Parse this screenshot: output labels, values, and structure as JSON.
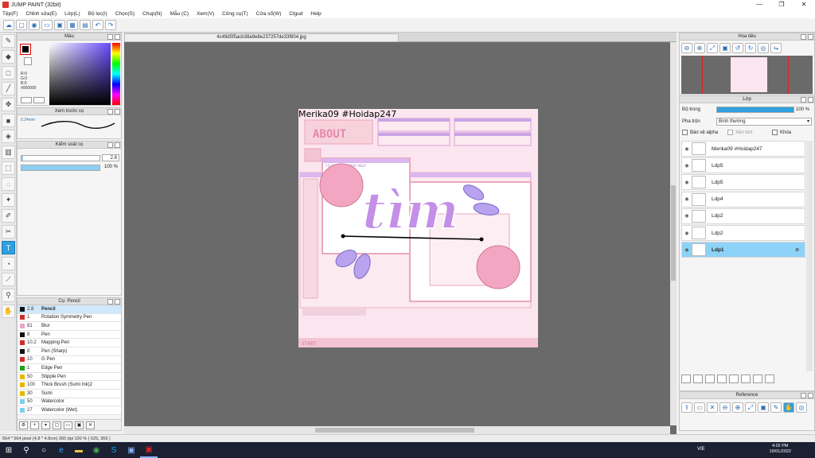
{
  "window": {
    "title": "JUMP PAINT (32bit)",
    "controls": [
      "—",
      "❐",
      "✕"
    ]
  },
  "menu": [
    "Tệp(F)",
    "Chỉnh sửa(E)",
    "Lớp(L)",
    "Bộ lọc(I)",
    "Chọn(S)",
    "Chụp(N)",
    "Mẫu (C)",
    "Xem(V)",
    "Công cụ(T)",
    "Cửa sổ(W)",
    "Clgud",
    "Help"
  ],
  "canvas_tab": "4c49d5f5acb38a9e8e237257de33f804.jpg",
  "panels": {
    "color": "Màu",
    "preview": "Xem trước cọ",
    "control": "Kiểm soát cọ",
    "brush": "Cọ: Pencil",
    "navigator": "Hoa tiêu",
    "layer": "Lớp",
    "reference": "Reference"
  },
  "color": {
    "r": "R:0",
    "g": "G:0",
    "b": "B:0",
    "hex": "#000000",
    "main": "#000000"
  },
  "preview": {
    "size": "0.24mm"
  },
  "brush_control": {
    "size": "2.8",
    "opacity": "100 %",
    "opacity_fraction": 1.0
  },
  "brushes": [
    {
      "num": "2.8",
      "name": "Pencil",
      "color": "#111111",
      "selected": true
    },
    {
      "num": "1",
      "name": "Rotation Symmetry Pen",
      "color": "#d62b2b"
    },
    {
      "num": "81",
      "name": "Blur",
      "color": "#e8a6c8"
    },
    {
      "num": "8",
      "name": "Pen",
      "color": "#111111"
    },
    {
      "num": "10.2",
      "name": "Mapping Pen",
      "color": "#d62b2b"
    },
    {
      "num": "8",
      "name": "Pen (Sharp)",
      "color": "#111111"
    },
    {
      "num": "10",
      "name": "G Pen",
      "color": "#d62b2b"
    },
    {
      "num": "1",
      "name": "Edge Pen",
      "color": "#1fa31f"
    },
    {
      "num": "50",
      "name": "Stipple Pen",
      "color": "#e6b800"
    },
    {
      "num": "100",
      "name": "Thick Brush (Sumi Ink)2",
      "color": "#e6b800"
    },
    {
      "num": "30",
      "name": "Sumi",
      "color": "#e6b800"
    },
    {
      "num": "50",
      "name": "Watercolor",
      "color": "#7fcfee"
    },
    {
      "num": "27",
      "name": "Watercolor (Wet)",
      "color": "#7fcfee"
    }
  ],
  "layer": {
    "opacity_label": "Độ trong",
    "opacity_value": "100 %",
    "opacity_fraction": 1.0,
    "blend_label": "Pha trộn",
    "blend_value": "Bình thường",
    "protect_alpha": "Bảo vệ alpha",
    "clipping": "Xén bớt",
    "lock": "Khóa",
    "items": [
      {
        "name": "Merika09 #Hoidap247",
        "selected": false
      },
      {
        "name": "Ldp5",
        "selected": false
      },
      {
        "name": "Ldp5",
        "selected": false
      },
      {
        "name": "Ldp4",
        "selected": false
      },
      {
        "name": "Ldp2",
        "selected": false
      },
      {
        "name": "Ldp2",
        "selected": false
      },
      {
        "name": "Ldp1",
        "selected": true
      }
    ]
  },
  "artwork": {
    "caption": "Merika09 #Hoidap247",
    "word": "tìm",
    "about": "ABOUT",
    "start": "START",
    "menu_labels": [
      "FILE  EDIT  SEARCH  HELP"
    ]
  },
  "status": "564 * 564 pixel  (4.8 * 4.8cm)  300 dpi  100 %  ( 625, 369 )",
  "tray": {
    "lang": "VIE",
    "time": "4:02 PM",
    "date": "19/01/2022"
  }
}
